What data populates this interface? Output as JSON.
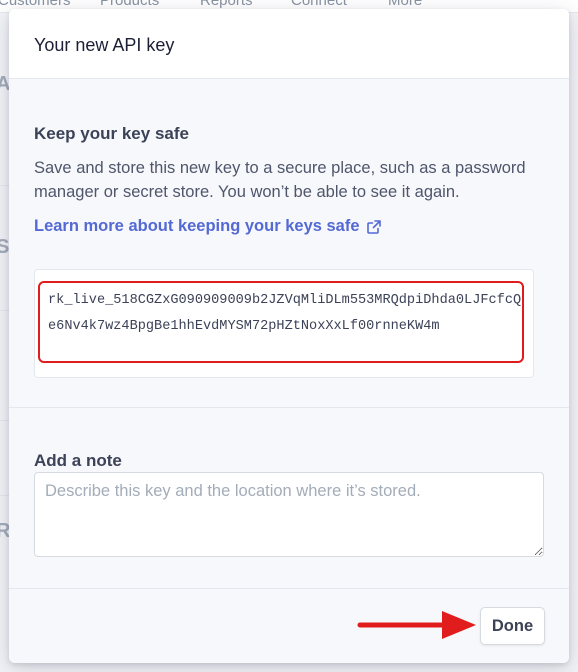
{
  "background": {
    "nav_items": [
      "Customers",
      "Products",
      "Reports",
      "Connect",
      "More"
    ]
  },
  "modal": {
    "title": "Your new API key",
    "safety": {
      "heading": "Keep your key safe",
      "description": "Save and store this new key to a secure place, such as a password manager or secret store. You won’t be able to see it again.",
      "learn_more_label": "Learn more about keeping your keys safe",
      "api_key": "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"
    },
    "note": {
      "heading": "Add a note",
      "placeholder": "Describe this key and the location where it’s stored.",
      "value": ""
    },
    "done_label": "Done"
  },
  "colors": {
    "link": "#5469d4",
    "highlight": "#e01c1c",
    "arrow": "#e01c1c"
  },
  "icons": {
    "external_link": "external-link-icon",
    "arrow": "right-arrow-annotation"
  }
}
